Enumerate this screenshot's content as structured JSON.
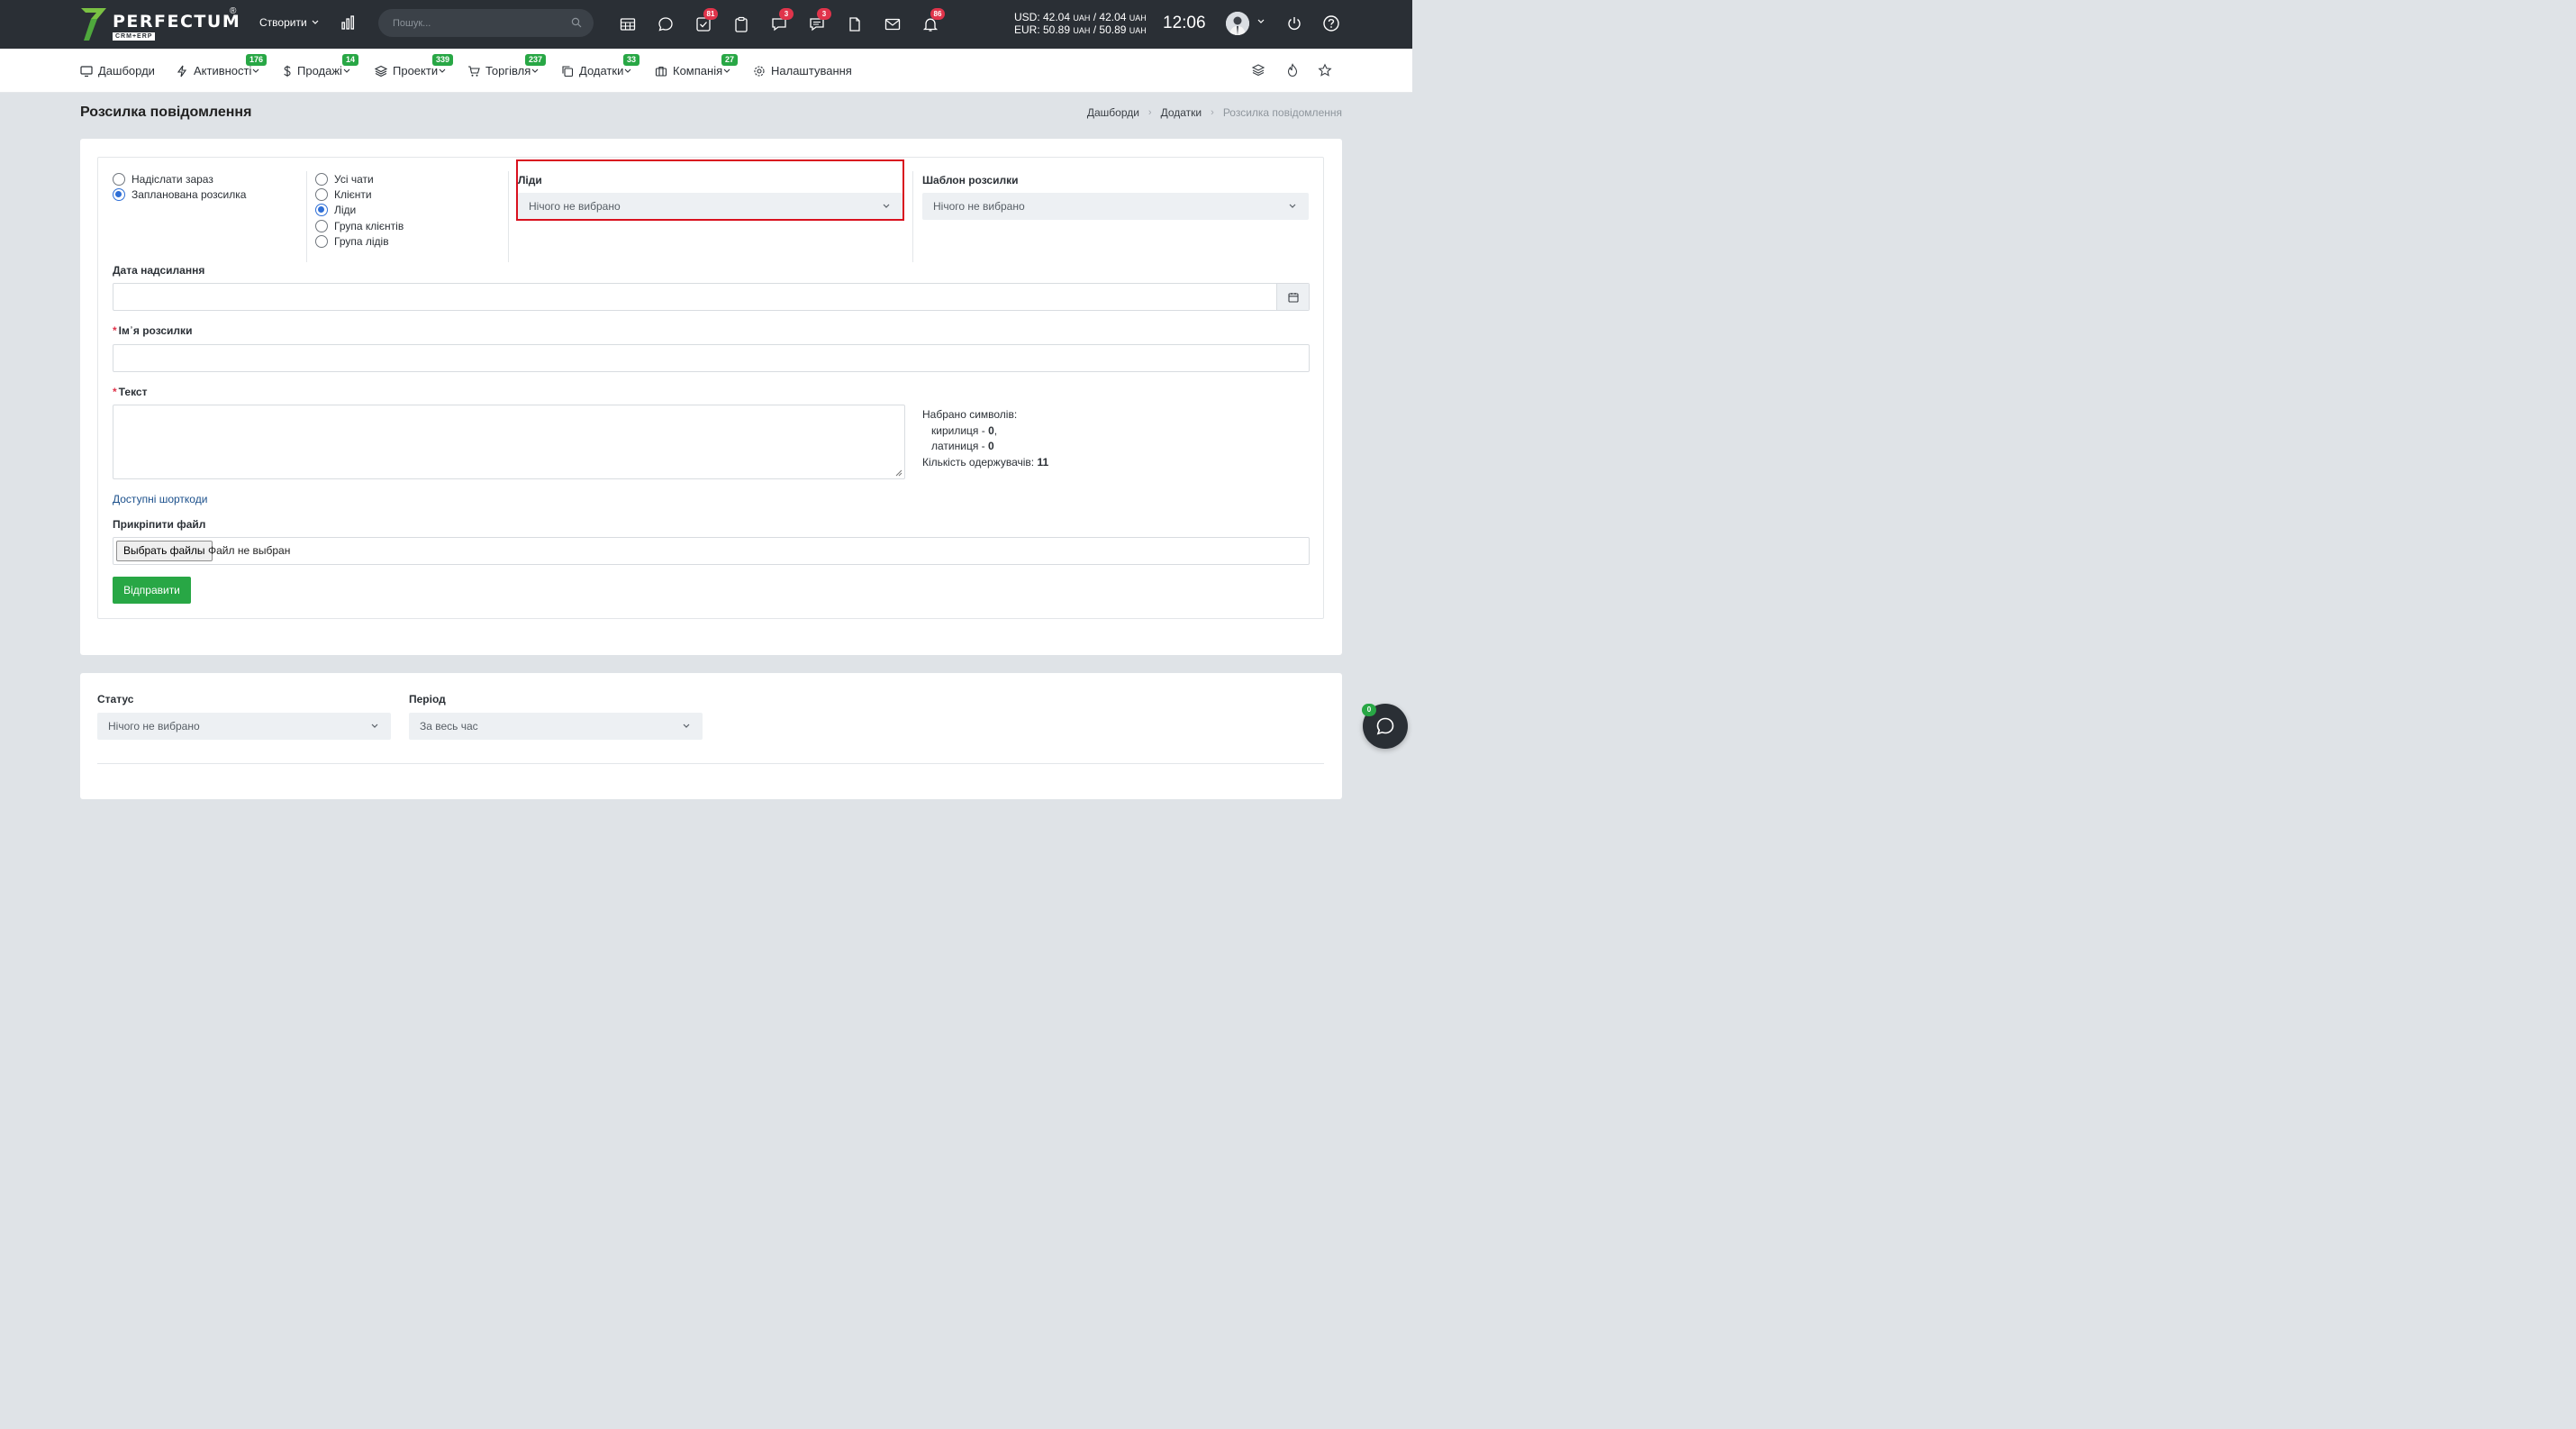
{
  "header": {
    "logo_text": "PERFECTUM",
    "logo_reg": "®",
    "logo_sub": "CRM+ERP",
    "create_label": "Створити",
    "search_placeholder": "Пошук...",
    "badges": {
      "tasks": "81",
      "chat": "3",
      "messages": "3",
      "notifications": "86"
    },
    "usd_label": "USD: 42.04",
    "usd_unit": "UAH",
    "usd_sep": " / 42.04 ",
    "eur_label": "EUR: 50.89",
    "eur_sep": " / 50.89 ",
    "time": "12:06"
  },
  "nav": {
    "items": [
      {
        "label": "Дашборди",
        "badge": ""
      },
      {
        "label": "Активності",
        "badge": "176"
      },
      {
        "label": "Продажі",
        "badge": "14"
      },
      {
        "label": "Проекти",
        "badge": "339"
      },
      {
        "label": "Торгівля",
        "badge": "237"
      },
      {
        "label": "Додатки",
        "badge": "33"
      },
      {
        "label": "Компанія",
        "badge": "27"
      },
      {
        "label": "Налаштування",
        "badge": ""
      }
    ]
  },
  "page": {
    "title": "Розсилка повідомлення",
    "breadcrumb": [
      "Дашборди",
      "Додатки",
      "Розсилка повідомлення"
    ]
  },
  "form": {
    "send_mode": {
      "options": [
        "Надіслати зараз",
        "Запланована розсилка"
      ],
      "selected": 1
    },
    "recipients": {
      "options": [
        "Усі чати",
        "Клієнти",
        "Ліди",
        "Група клієнтів",
        "Група лідів"
      ],
      "selected": 2
    },
    "leads_label": "Ліди",
    "leads_value": "Нічого не вибрано",
    "template_label": "Шаблон розсилки",
    "template_value": "Нічого не вибрано",
    "date_label": "Дата надсилання",
    "name_label": "Ім᾿я розсилки",
    "text_label": "Текст",
    "required_mark": "*",
    "stats_title": "Набрано символів:",
    "cyrillic_label": "кирилиця - ",
    "cyrillic_count": "0",
    "latin_label": "латиниця - ",
    "latin_count": "0",
    "recipients_label": "Кількість одержувачів: ",
    "recipients_count": "11",
    "shortcodes_link": "Доступні шорткоди",
    "attach_label": "Прикріпити файл",
    "file_button": "Выбрать файлы",
    "file_status": "Файл не выбран",
    "submit_label": "Відправити"
  },
  "filters": {
    "status_label": "Статус",
    "status_value": "Нічого не вибрано",
    "period_label": "Період",
    "period_value": "За весь час"
  },
  "chat_fab": {
    "badge": "0"
  },
  "colors": {
    "topbar": "#2a2f35",
    "accent_green": "#28a745",
    "badge_red": "#e0344b",
    "highlight_red": "#d9101e",
    "radio_blue": "#2f6fd6"
  }
}
